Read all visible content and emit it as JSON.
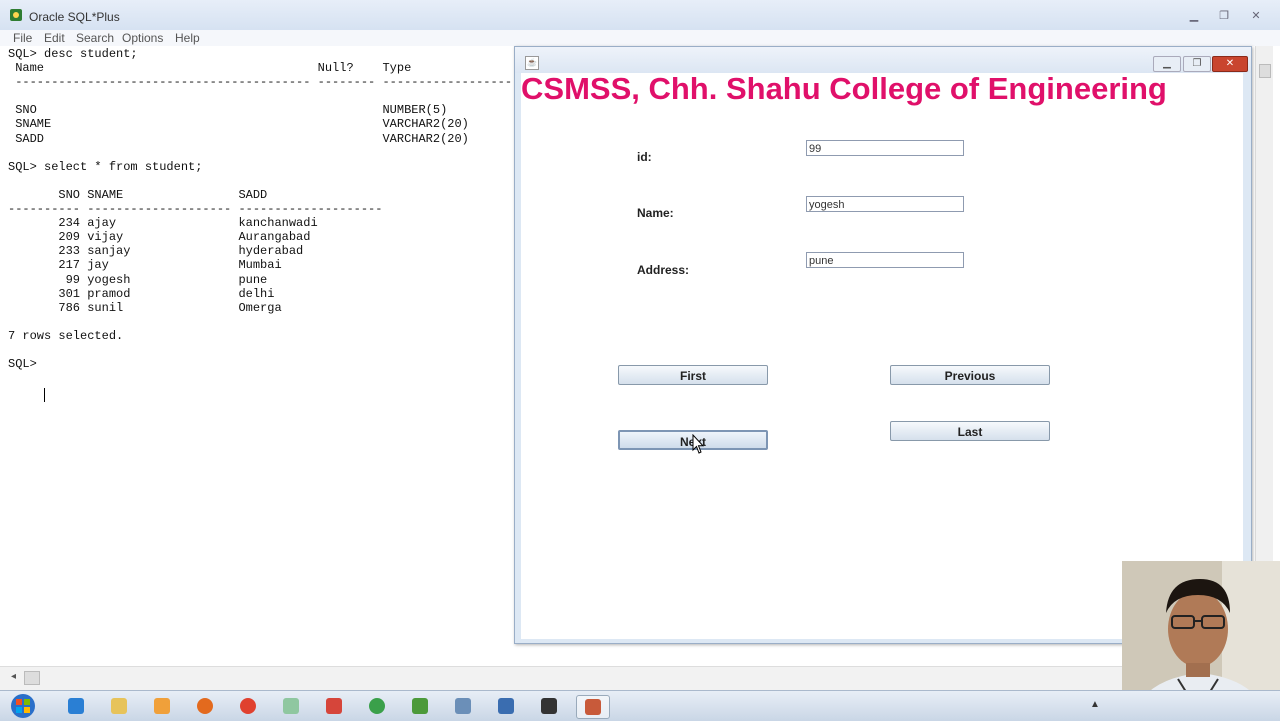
{
  "sqlplus": {
    "title": "Oracle SQL*Plus",
    "menu": [
      "File",
      "Edit",
      "Search",
      "Options",
      "Help"
    ],
    "console_lines": [
      "SQL> desc student;",
      " Name                                      Null?    Type",
      " ----------------------------------------- -------- ----------------------------",
      "",
      " SNO                                                NUMBER(5)",
      " SNAME                                              VARCHAR2(20)",
      " SADD                                               VARCHAR2(20)",
      "",
      "SQL> select * from student;",
      "",
      "       SNO SNAME                SADD",
      "---------- -------------------- --------------------",
      "       234 ajay                 kanchanwadi",
      "       209 vijay                Aurangabad",
      "       233 sanjay               hyderabad",
      "       217 jay                  Mumbai",
      "        99 yogesh               pune",
      "       301 pramod               delhi",
      "       786 sunil                Omerga",
      "",
      "7 rows selected.",
      "",
      "SQL> "
    ]
  },
  "form": {
    "heading": "CSMSS, Chh. Shahu College of Engineering",
    "fields": [
      {
        "label": "id:",
        "value": "99"
      },
      {
        "label": "Name:",
        "value": "yogesh"
      },
      {
        "label": "Address:",
        "value": "pune"
      }
    ],
    "buttons": {
      "first": "First",
      "previous": "Previous",
      "next": "Next",
      "last": "Last"
    }
  },
  "taskbar": {
    "icons": [
      "ie-icon",
      "folder-icon",
      "media-player-icon",
      "firefox-icon",
      "chrome-icon",
      "files-icon",
      "pdf-icon",
      "green-app-icon",
      "puzzle-icon",
      "window-icon",
      "box-icon",
      "save-icon",
      "java-icon"
    ]
  }
}
